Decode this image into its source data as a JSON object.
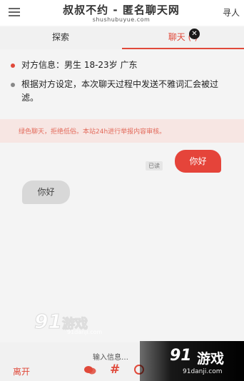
{
  "header": {
    "title": "叔叔不约 - 匿名聊天网",
    "subtitle": "shushubuyue.com",
    "find_label": "寻人"
  },
  "tabs": [
    {
      "label": "探索",
      "active": false
    },
    {
      "label": "聊天 (-)",
      "active": true
    }
  ],
  "info": {
    "partner": "对方信息：男生 18-23岁 广东",
    "filter_notice": "根据对方设定，本次聊天过程中发送不雅词汇会被过滤。"
  },
  "notice": {
    "text": "绿色聊天，拒绝低俗。本站24h进行举报内容审核。"
  },
  "messages": [
    {
      "direction": "sent",
      "text": "你好",
      "status": "已读"
    },
    {
      "direction": "received",
      "text": "你好"
    }
  ],
  "footer": {
    "input_placeholder": "输入信息…",
    "leave_label": "离开"
  },
  "watermark": {
    "brand_number": "91",
    "brand_text": "游戏",
    "url": "91danji.com"
  },
  "colors": {
    "accent": "#e0493a",
    "sent_bubble": "#e5443a",
    "received_bubble": "#d8d8d8",
    "notice_bg": "#f7e6e3"
  },
  "icons": [
    "menu-icon",
    "close-icon",
    "chat-icon",
    "hash-icon",
    "more-icon"
  ]
}
